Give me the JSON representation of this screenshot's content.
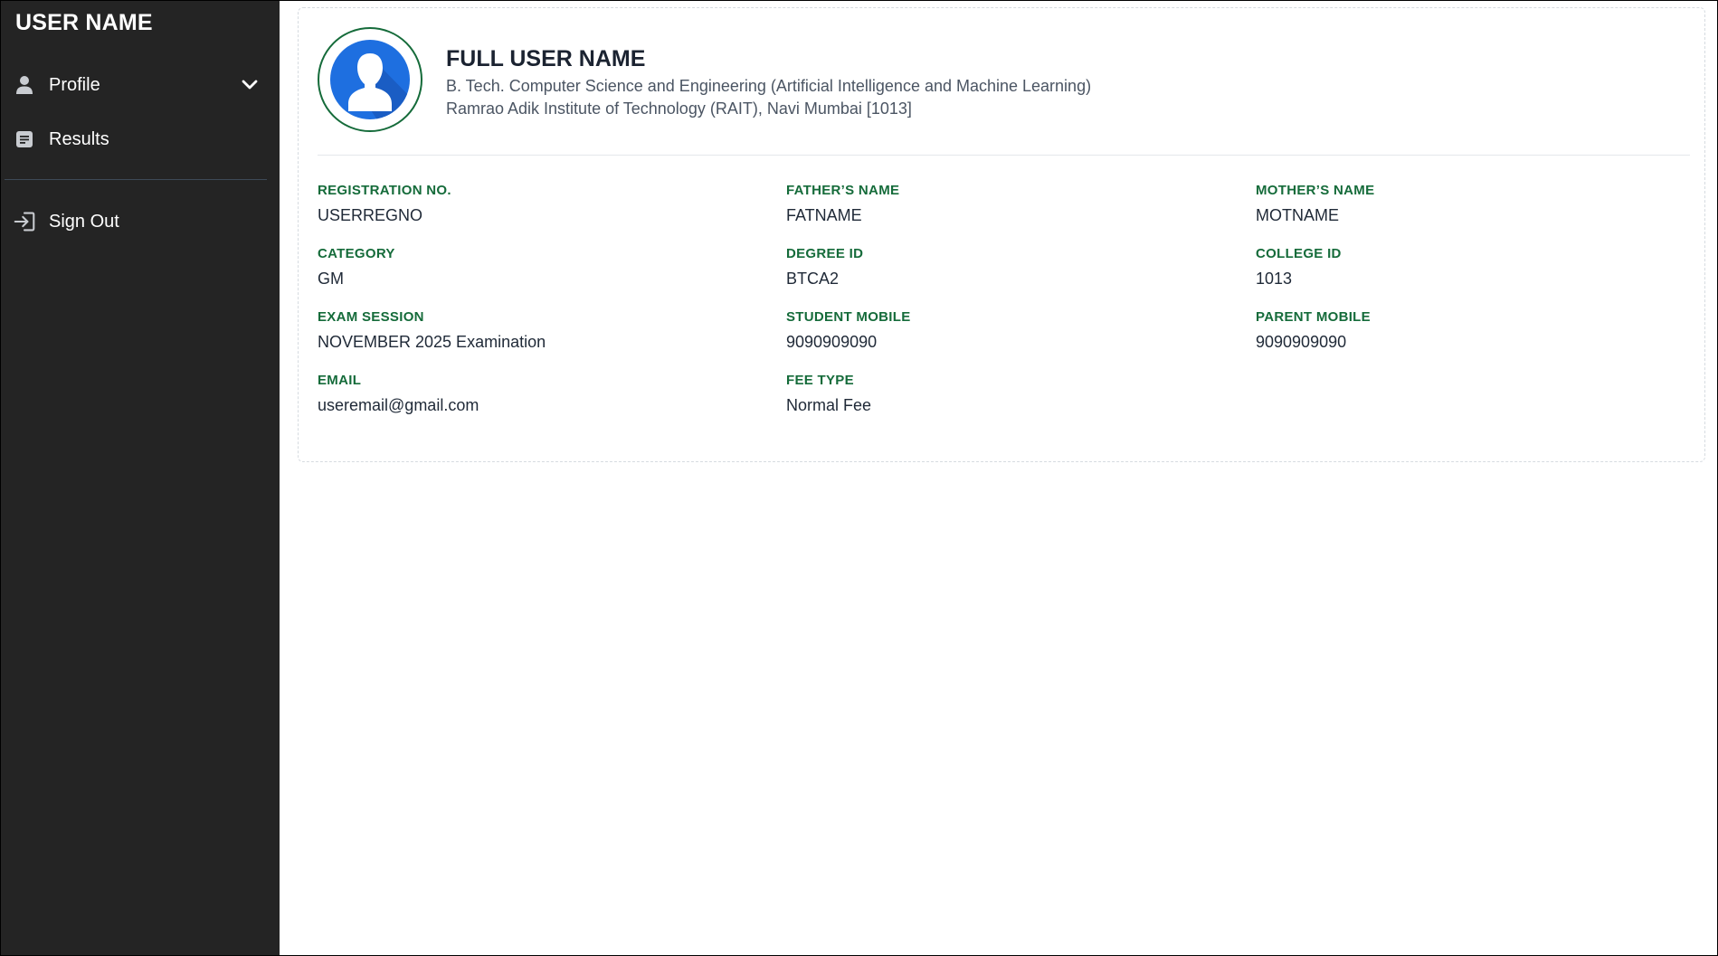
{
  "sidebar": {
    "user_name": "USER NAME",
    "items": [
      {
        "label": "Profile",
        "icon": "person-icon",
        "has_chevron": true
      },
      {
        "label": "Results",
        "icon": "document-icon",
        "has_chevron": false
      },
      {
        "label": "Sign Out",
        "icon": "sign-in-arrow-icon",
        "has_chevron": false
      }
    ]
  },
  "profile": {
    "full_name": "FULL USER NAME",
    "program": "B. Tech. Computer Science and Engineering (Artificial Intelligence and Machine Learning)",
    "institute": "Ramrao Adik Institute of Technology (RAIT), Navi Mumbai [1013]",
    "avatar_icon": "user-avatar-icon",
    "fields": [
      {
        "label": "REGISTRATION NO.",
        "value": "USERREGNO"
      },
      {
        "label": "FATHER’S NAME",
        "value": "FATNAME"
      },
      {
        "label": "MOTHER’S NAME",
        "value": "MOTNAME"
      },
      {
        "label": "CATEGORY",
        "value": "GM"
      },
      {
        "label": "DEGREE ID",
        "value": "BTCA2"
      },
      {
        "label": "COLLEGE ID",
        "value": "1013"
      },
      {
        "label": "EXAM SESSION",
        "value": "NOVEMBER 2025 Examination"
      },
      {
        "label": "STUDENT MOBILE",
        "value": "9090909090"
      },
      {
        "label": "PARENT MOBILE",
        "value": "9090909090"
      },
      {
        "label": "EMAIL",
        "value": "useremail@gmail.com"
      },
      {
        "label": "FEE TYPE",
        "value": "Normal Fee"
      }
    ]
  },
  "colors": {
    "sidebar_bg": "#242424",
    "accent_green": "#156b3a",
    "avatar_blue": "#1e6fe0"
  }
}
